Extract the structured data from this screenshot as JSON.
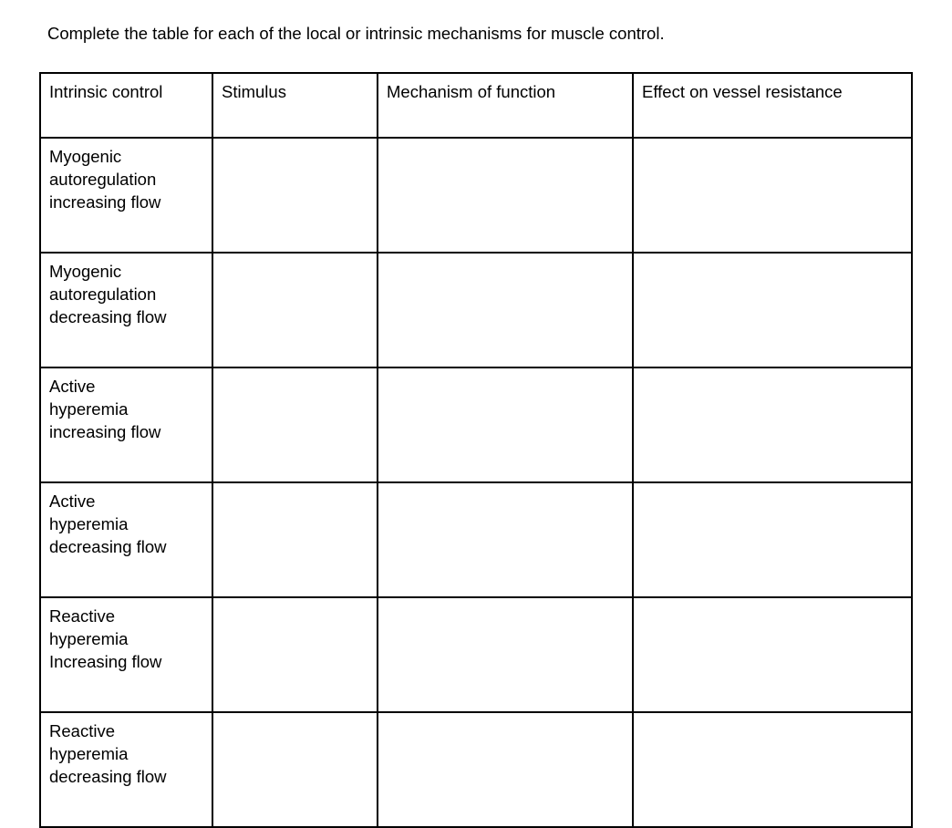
{
  "document": {
    "prompt": "Complete the table for each of the local or intrinsic mechanisms for muscle control."
  },
  "table": {
    "columns": [
      {
        "key": "intrinsic_control",
        "header": "Intrinsic control"
      },
      {
        "key": "stimulus",
        "header": "Stimulus"
      },
      {
        "key": "mechanism_of_function",
        "header": "Mechanism of function"
      },
      {
        "key": "effect_on_vessel_resistance",
        "header": "Effect on vessel resistance"
      }
    ],
    "rows": [
      {
        "intrinsic_control": "Myogenic\nautoregulation\nincreasing flow",
        "stimulus": "",
        "mechanism_of_function": "",
        "effect_on_vessel_resistance": ""
      },
      {
        "intrinsic_control": "Myogenic\nautoregulation\ndecreasing flow",
        "stimulus": "",
        "mechanism_of_function": "",
        "effect_on_vessel_resistance": ""
      },
      {
        "intrinsic_control": "Active\nhyperemia\nincreasing flow",
        "stimulus": "",
        "mechanism_of_function": "",
        "effect_on_vessel_resistance": ""
      },
      {
        "intrinsic_control": "Active\nhyperemia\ndecreasing flow",
        "stimulus": "",
        "mechanism_of_function": "",
        "effect_on_vessel_resistance": ""
      },
      {
        "intrinsic_control": "Reactive\nhyperemia\nIncreasing flow",
        "stimulus": "",
        "mechanism_of_function": "",
        "effect_on_vessel_resistance": ""
      },
      {
        "intrinsic_control": "Reactive\nhyperemia\ndecreasing flow",
        "stimulus": "",
        "mechanism_of_function": "",
        "effect_on_vessel_resistance": ""
      }
    ]
  },
  "colors": {
    "text": "#000000",
    "background": "#ffffff",
    "border": "#000000"
  }
}
